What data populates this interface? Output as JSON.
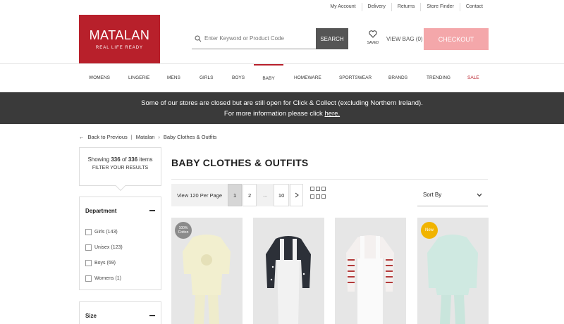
{
  "utility_links": [
    "My Account",
    "Delivery",
    "Returns",
    "Store Finder",
    "Contact"
  ],
  "logo": {
    "brand": "MATALAN",
    "tagline": "REAL LIFE READY",
    "color": "#b8202b"
  },
  "search": {
    "placeholder": "Enter Keyword or Product Code",
    "button": "SEARCH"
  },
  "saved_label": "SAVED",
  "bag_label": "VIEW BAG (0)",
  "checkout_label": "CHECKOUT",
  "nav": [
    "WOMENS",
    "LINGERIE",
    "MENS",
    "GIRLS",
    "BOYS",
    "BABY",
    "HOMEWARE",
    "SPORTSWEAR",
    "BRANDS",
    "TRENDING",
    "SALE"
  ],
  "banner": {
    "line1": "Some of our stores are closed but are still open for Click & Collect (excluding Northern Ireland).",
    "line2_prefix": "For more information please click ",
    "line2_link": "here."
  },
  "breadcrumb": {
    "back": "Back to Previous",
    "sep": "|",
    "level1": "Matalan",
    "level2": "Baby Clothes & Outfits"
  },
  "results": {
    "prefix": "Showing ",
    "shown": "336",
    "of": " of ",
    "total": "336",
    "suffix": " items",
    "filter_label": "FILTER YOUR RESULTS"
  },
  "facets": {
    "department": {
      "title": "Department",
      "options": [
        {
          "label": "Girls",
          "count": "(143)"
        },
        {
          "label": "Unisex",
          "count": "(123)"
        },
        {
          "label": "Boys",
          "count": "(69)"
        },
        {
          "label": "Womens",
          "count": "(1)"
        }
      ]
    },
    "size": {
      "title": "Size"
    }
  },
  "page_title": "BABY CLOTHES & OUTFITS",
  "pagination": {
    "per_page": "View 120 Per Page",
    "pages": [
      "1",
      "2",
      "...",
      "10"
    ],
    "current": "1"
  },
  "sort_label": "Sort By",
  "products": [
    {
      "badge": "100% Cotton",
      "badge_color": "#8b8b8b"
    },
    {
      "badge": ""
    },
    {
      "badge": ""
    },
    {
      "badge": "New",
      "badge_color": "#f1b400"
    }
  ]
}
